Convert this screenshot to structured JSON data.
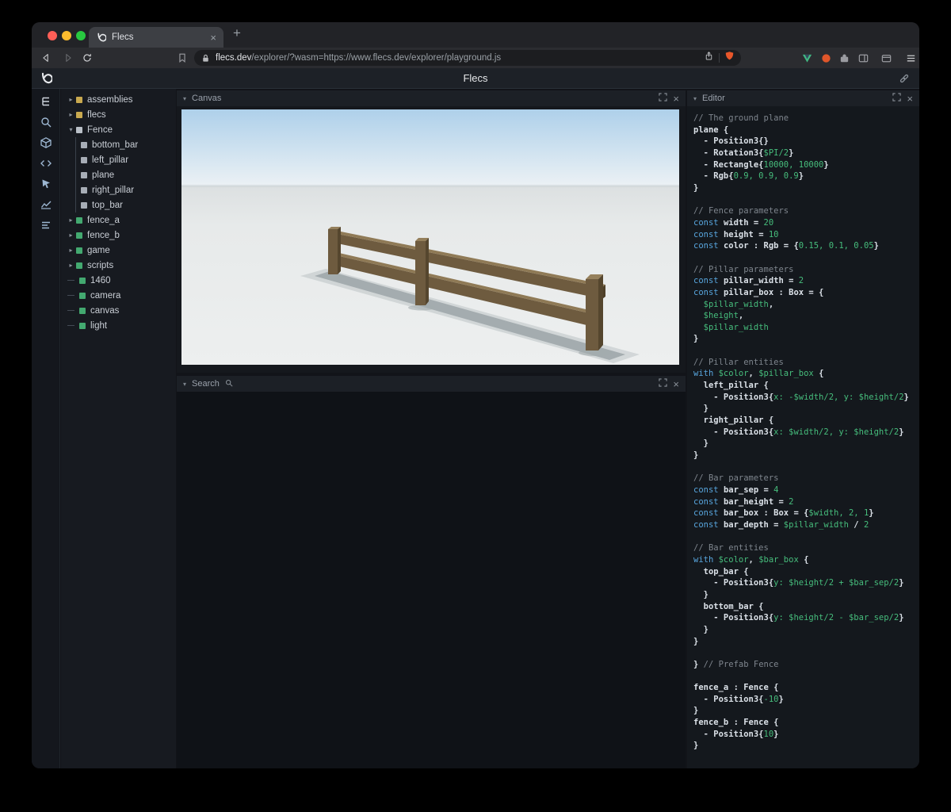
{
  "browser": {
    "tab_title": "Flecs",
    "url_domain": "flecs.dev",
    "url_path": "/explorer/?wasm=https://www.flecs.dev/explorer/playground.js",
    "new_tab_label": "+",
    "tab_close_label": "×"
  },
  "app": {
    "title": "Flecs"
  },
  "sidebar_icons": [
    "entity-tree-icon",
    "search-icon",
    "entities-icon",
    "code-icon",
    "inspect-icon",
    "chart-icon",
    "stats-icon"
  ],
  "panels": {
    "canvas": {
      "title": "Canvas",
      "close_label": "×"
    },
    "search": {
      "title": "Search",
      "close_label": "×"
    },
    "editor": {
      "title": "Editor",
      "close_label": "×"
    }
  },
  "tree": {
    "items": [
      {
        "label": "assemblies",
        "arrow": "right",
        "dot": "module",
        "indent": 0
      },
      {
        "label": "flecs",
        "arrow": "right",
        "dot": "module",
        "indent": 0
      },
      {
        "label": "Fence",
        "arrow": "down",
        "dot": "prefab",
        "indent": 0
      },
      {
        "label": "bottom_bar",
        "arrow": "none",
        "dot": "child",
        "indent": 1
      },
      {
        "label": "left_pillar",
        "arrow": "none",
        "dot": "child",
        "indent": 1
      },
      {
        "label": "plane",
        "arrow": "none",
        "dot": "child",
        "indent": 1
      },
      {
        "label": "right_pillar",
        "arrow": "none",
        "dot": "child",
        "indent": 1
      },
      {
        "label": "top_bar",
        "arrow": "none",
        "dot": "child",
        "indent": 1
      },
      {
        "label": "fence_a",
        "arrow": "right",
        "dot": "entity",
        "indent": 0
      },
      {
        "label": "fence_b",
        "arrow": "right",
        "dot": "entity",
        "indent": 0
      },
      {
        "label": "game",
        "arrow": "right",
        "dot": "entity",
        "indent": 0
      },
      {
        "label": "scripts",
        "arrow": "right",
        "dot": "entity",
        "indent": 0
      },
      {
        "label": "1460",
        "arrow": "leaf",
        "dot": "entity",
        "indent": 0
      },
      {
        "label": "camera",
        "arrow": "leaf",
        "dot": "entity",
        "indent": 0
      },
      {
        "label": "canvas",
        "arrow": "leaf",
        "dot": "entity",
        "indent": 0
      },
      {
        "label": "light",
        "arrow": "leaf",
        "dot": "entity",
        "indent": 0
      }
    ]
  },
  "colors": {
    "keyword_blue": "#58a6de",
    "value_green": "#46bd7c",
    "comment_gray": "#7e858d",
    "module_yellow": "#c9a94f",
    "prefab_gray": "#bac0c8",
    "entity_green": "#43a970",
    "fence_brown": "#6e5b3f",
    "sky_blue": "#aed0ea"
  },
  "editor": {
    "lines": [
      [
        {
          "c": "cm",
          "s": "// The ground plane"
        }
      ],
      [
        {
          "c": "id",
          "s": "plane {"
        }
      ],
      [
        {
          "c": "id",
          "s": "  - Position3{}"
        }
      ],
      [
        {
          "c": "id",
          "s": "  - Rotation3{"
        },
        {
          "c": "v",
          "s": "$PI/2"
        },
        {
          "c": "id",
          "s": "}"
        }
      ],
      [
        {
          "c": "id",
          "s": "  - Rectangle{"
        },
        {
          "c": "v",
          "s": "10000, 10000"
        },
        {
          "c": "id",
          "s": "}"
        }
      ],
      [
        {
          "c": "id",
          "s": "  - Rgb{"
        },
        {
          "c": "v",
          "s": "0.9, 0.9, 0.9"
        },
        {
          "c": "id",
          "s": "}"
        }
      ],
      [
        {
          "c": "id",
          "s": "}"
        }
      ],
      [],
      [
        {
          "c": "cm",
          "s": "// Fence parameters"
        }
      ],
      [
        {
          "c": "kw",
          "s": "const "
        },
        {
          "c": "id",
          "s": "width = "
        },
        {
          "c": "v",
          "s": "20"
        }
      ],
      [
        {
          "c": "kw",
          "s": "const "
        },
        {
          "c": "id",
          "s": "height = "
        },
        {
          "c": "v",
          "s": "10"
        }
      ],
      [
        {
          "c": "kw",
          "s": "const "
        },
        {
          "c": "id",
          "s": "color : Rgb = {"
        },
        {
          "c": "v",
          "s": "0.15, 0.1, 0.05"
        },
        {
          "c": "id",
          "s": "}"
        }
      ],
      [],
      [
        {
          "c": "cm",
          "s": "// Pillar parameters"
        }
      ],
      [
        {
          "c": "kw",
          "s": "const "
        },
        {
          "c": "id",
          "s": "pillar_width = "
        },
        {
          "c": "v",
          "s": "2"
        }
      ],
      [
        {
          "c": "kw",
          "s": "const "
        },
        {
          "c": "id",
          "s": "pillar_box : Box = {"
        }
      ],
      [
        {
          "c": "id",
          "s": "  "
        },
        {
          "c": "v",
          "s": "$pillar_width"
        },
        {
          "c": "id",
          "s": ","
        }
      ],
      [
        {
          "c": "id",
          "s": "  "
        },
        {
          "c": "v",
          "s": "$height"
        },
        {
          "c": "id",
          "s": ","
        }
      ],
      [
        {
          "c": "id",
          "s": "  "
        },
        {
          "c": "v",
          "s": "$pillar_width"
        }
      ],
      [
        {
          "c": "id",
          "s": "}"
        }
      ],
      [],
      [
        {
          "c": "cm",
          "s": "// Pillar entities"
        }
      ],
      [
        {
          "c": "kw",
          "s": "with "
        },
        {
          "c": "v",
          "s": "$color"
        },
        {
          "c": "id",
          "s": ", "
        },
        {
          "c": "v",
          "s": "$pillar_box"
        },
        {
          "c": "id",
          "s": " {"
        }
      ],
      [
        {
          "c": "id",
          "s": "  left_pillar {"
        }
      ],
      [
        {
          "c": "id",
          "s": "    - Position3{"
        },
        {
          "c": "v",
          "s": "x: -$width/2, y: $height/2"
        },
        {
          "c": "id",
          "s": "}"
        }
      ],
      [
        {
          "c": "id",
          "s": "  }"
        }
      ],
      [
        {
          "c": "id",
          "s": "  right_pillar {"
        }
      ],
      [
        {
          "c": "id",
          "s": "    - Position3{"
        },
        {
          "c": "v",
          "s": "x: $width/2, y: $height/2"
        },
        {
          "c": "id",
          "s": "}"
        }
      ],
      [
        {
          "c": "id",
          "s": "  }"
        }
      ],
      [
        {
          "c": "id",
          "s": "}"
        }
      ],
      [],
      [
        {
          "c": "cm",
          "s": "// Bar parameters"
        }
      ],
      [
        {
          "c": "kw",
          "s": "const "
        },
        {
          "c": "id",
          "s": "bar_sep = "
        },
        {
          "c": "v",
          "s": "4"
        }
      ],
      [
        {
          "c": "kw",
          "s": "const "
        },
        {
          "c": "id",
          "s": "bar_height = "
        },
        {
          "c": "v",
          "s": "2"
        }
      ],
      [
        {
          "c": "kw",
          "s": "const "
        },
        {
          "c": "id",
          "s": "bar_box : Box = {"
        },
        {
          "c": "v",
          "s": "$width, 2, 1"
        },
        {
          "c": "id",
          "s": "}"
        }
      ],
      [
        {
          "c": "kw",
          "s": "const "
        },
        {
          "c": "id",
          "s": "bar_depth = "
        },
        {
          "c": "v",
          "s": "$pillar_width"
        },
        {
          "c": "id",
          "s": " / "
        },
        {
          "c": "v",
          "s": "2"
        }
      ],
      [],
      [
        {
          "c": "cm",
          "s": "// Bar entities"
        }
      ],
      [
        {
          "c": "kw",
          "s": "with "
        },
        {
          "c": "v",
          "s": "$color"
        },
        {
          "c": "id",
          "s": ", "
        },
        {
          "c": "v",
          "s": "$bar_box"
        },
        {
          "c": "id",
          "s": " {"
        }
      ],
      [
        {
          "c": "id",
          "s": "  top_bar {"
        }
      ],
      [
        {
          "c": "id",
          "s": "    - Position3{"
        },
        {
          "c": "v",
          "s": "y: $height/2 + $bar_sep/2"
        },
        {
          "c": "id",
          "s": "}"
        }
      ],
      [
        {
          "c": "id",
          "s": "  }"
        }
      ],
      [
        {
          "c": "id",
          "s": "  bottom_bar {"
        }
      ],
      [
        {
          "c": "id",
          "s": "    - Position3{"
        },
        {
          "c": "v",
          "s": "y: $height/2 - $bar_sep/2"
        },
        {
          "c": "id",
          "s": "}"
        }
      ],
      [
        {
          "c": "id",
          "s": "  }"
        }
      ],
      [
        {
          "c": "id",
          "s": "}"
        }
      ],
      [],
      [
        {
          "c": "id",
          "s": "} "
        },
        {
          "c": "cm",
          "s": "// Prefab Fence"
        }
      ],
      [],
      [
        {
          "c": "id",
          "s": "fence_a : Fence {"
        }
      ],
      [
        {
          "c": "id",
          "s": "  - Position3{"
        },
        {
          "c": "v",
          "s": "-10"
        },
        {
          "c": "id",
          "s": "}"
        }
      ],
      [
        {
          "c": "id",
          "s": "}"
        }
      ],
      [
        {
          "c": "id",
          "s": "fence_b : Fence {"
        }
      ],
      [
        {
          "c": "id",
          "s": "  - Position3{"
        },
        {
          "c": "v",
          "s": "10"
        },
        {
          "c": "id",
          "s": "}"
        }
      ],
      [
        {
          "c": "id",
          "s": "}"
        }
      ]
    ]
  }
}
